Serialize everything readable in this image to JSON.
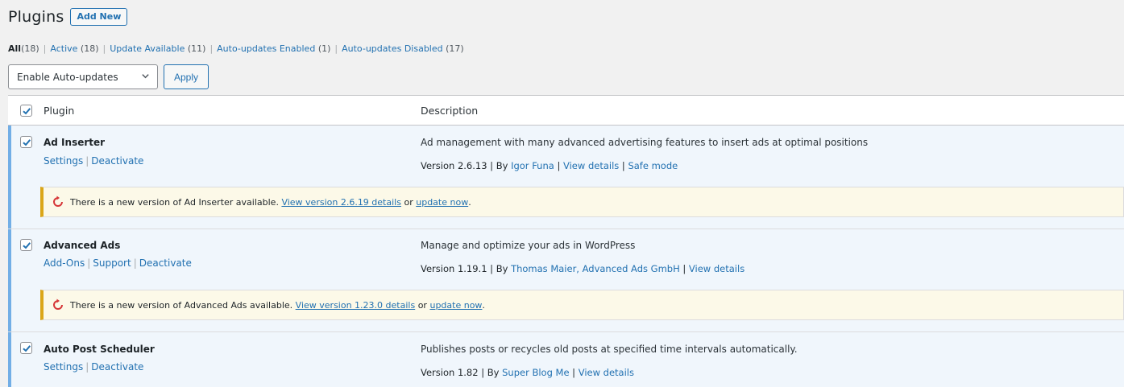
{
  "header": {
    "title": "Plugins",
    "add_new_label": "Add New"
  },
  "filters": [
    {
      "label": "All",
      "count": "(18)",
      "current": true
    },
    {
      "label": "Active",
      "count": "(18)"
    },
    {
      "label": "Update Available",
      "count": "(11)"
    },
    {
      "label": "Auto-updates Enabled",
      "count": "(1)"
    },
    {
      "label": "Auto-updates Disabled",
      "count": "(17)"
    }
  ],
  "separator": "|",
  "bulk": {
    "selected": "Enable Auto-updates",
    "apply_label": "Apply"
  },
  "columns": {
    "plugin": "Plugin",
    "description": "Description"
  },
  "plugins": [
    {
      "name": "Ad Inserter",
      "actions": [
        "Settings",
        "Deactivate"
      ],
      "description": "Ad management with many advanced advertising features to insert ads at optimal positions",
      "version_text": "Version 2.6.13",
      "by_text": "By",
      "author": "Igor Funa",
      "links": [
        "View details",
        "Safe mode"
      ],
      "notice": {
        "pre": "There is a new version of Ad Inserter available.",
        "link1": "View version 2.6.19 details",
        "mid": "or",
        "link2": "update now",
        "post": "."
      }
    },
    {
      "name": "Advanced Ads",
      "actions": [
        "Add-Ons",
        "Support",
        "Deactivate"
      ],
      "description": "Manage and optimize your ads in WordPress",
      "version_text": "Version 1.19.1",
      "by_text": "By",
      "author": "Thomas Maier, Advanced Ads GmbH",
      "links": [
        "View details"
      ],
      "notice": {
        "pre": "There is a new version of Advanced Ads available.",
        "link1": "View version 1.23.0 details",
        "mid": "or",
        "link2": "update now",
        "post": "."
      }
    },
    {
      "name": "Auto Post Scheduler",
      "actions": [
        "Settings",
        "Deactivate"
      ],
      "description": "Publishes posts or recycles old posts at specified time intervals automatically.",
      "version_text": "Version 1.82",
      "by_text": "By",
      "author": "Super Blog Me",
      "links": [
        "View details"
      ]
    }
  ],
  "icons": {
    "checkbox": "checkmark-icon",
    "update": "update-icon",
    "select": "chevron-down-icon"
  },
  "colors": {
    "link": "#2271b1",
    "active_border": "#72aee6",
    "notice_border": "#dba617",
    "notice_bg": "#fcf9e8",
    "update_icon": "#d63638"
  }
}
